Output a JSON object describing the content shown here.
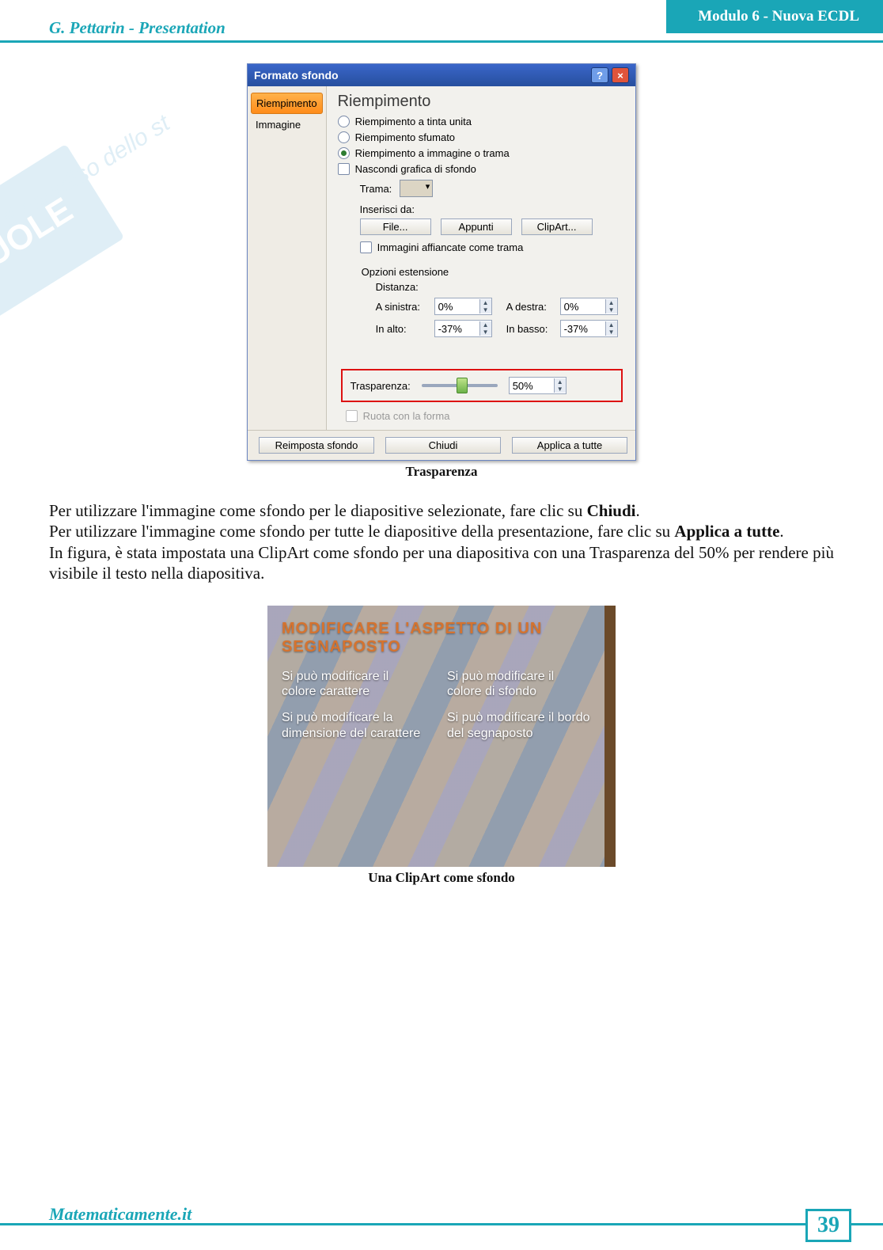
{
  "header": {
    "left": "G. Pettarin - Presentation",
    "right": "Modulo 6 - Nuova ECDL"
  },
  "watermark": {
    "logo": "SKUOLE",
    "tag": "il paradiso dello st"
  },
  "dialog": {
    "title": "Formato sfondo",
    "help": "?",
    "close": "×",
    "tabs": {
      "fill": "Riempimento",
      "image": "Immagine"
    },
    "pane_title": "Riempimento",
    "opt_solid": "Riempimento a tinta unita",
    "opt_gradient": "Riempimento sfumato",
    "opt_picture": "Riempimento a immagine o trama",
    "opt_hidebg": "Nascondi grafica di sfondo",
    "trama_label": "Trama:",
    "insert_label": "Inserisci da:",
    "btn_file": "File...",
    "btn_clip": "Appunti",
    "btn_clipart": "ClipArt...",
    "tile_label": "Immagini affiancate come trama",
    "ext_label": "Opzioni estensione",
    "dist_label": "Distanza:",
    "left_label": "A sinistra:",
    "left_val": "0%",
    "right_label": "A destra:",
    "right_val": "0%",
    "top_label": "In alto:",
    "top_val": "-37%",
    "bottom_label": "In basso:",
    "bottom_val": "-37%",
    "trans_label": "Trasparenza:",
    "trans_val": "50%",
    "rotate_label": "Ruota con la forma",
    "foot_reset": "Reimposta sfondo",
    "foot_close": "Chiudi",
    "foot_all": "Applica a tutte"
  },
  "captions": {
    "fig1": "Trasparenza",
    "fig2": "Una ClipArt come sfondo"
  },
  "body": {
    "p1a": "Per utilizzare l'immagine come sfondo per le diapositive selezionate, fare clic su ",
    "p1b": "Chiudi",
    "p1c": ".",
    "p2a": "Per utilizzare l'immagine come sfondo per tutte le diapositive della presentazione, fare clic su ",
    "p2b": "Applica a tutte",
    "p2c": ".",
    "p3": "In figura, è stata impostata una ClipArt come sfondo per una diapositiva con una Trasparenza del 50% per rendere più visibile il testo nella diapositiva."
  },
  "slide": {
    "title": "MODIFICARE L'ASPETTO DI UN SEGNAPOSTO",
    "l1": "Si può modificare il colore carattere",
    "l2": "Si può modificare la dimensione del carattere",
    "r1": "Si può modificare il colore di sfondo",
    "r2": "Si può modificare il bordo del segnaposto"
  },
  "footer": {
    "site": "Matematicamente.it",
    "page": "39"
  }
}
